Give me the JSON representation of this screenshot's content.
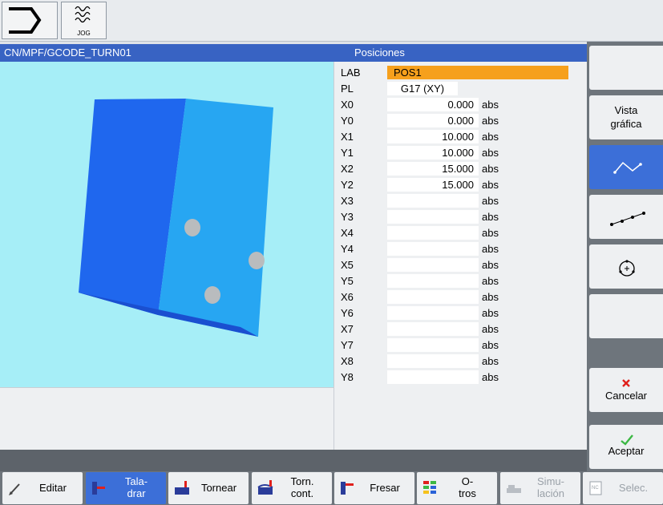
{
  "topbar": {
    "jog_label": "JOG"
  },
  "title": {
    "path": "CN/MPF/GCODE_TURN01",
    "section": "Posiciones"
  },
  "params": [
    {
      "label": "LAB",
      "value": "POS1",
      "unit": "",
      "style": "lab"
    },
    {
      "label": "PL",
      "value": "G17 (XY)",
      "unit": "",
      "style": "center"
    },
    {
      "label": "X0",
      "value": "0.000",
      "unit": "abs"
    },
    {
      "label": "Y0",
      "value": "0.000",
      "unit": "abs"
    },
    {
      "label": "X1",
      "value": "10.000",
      "unit": "abs"
    },
    {
      "label": "Y1",
      "value": "10.000",
      "unit": "abs"
    },
    {
      "label": "X2",
      "value": "15.000",
      "unit": "abs"
    },
    {
      "label": "Y2",
      "value": "15.000",
      "unit": "abs"
    },
    {
      "label": "X3",
      "value": "",
      "unit": "abs"
    },
    {
      "label": "Y3",
      "value": "",
      "unit": "abs"
    },
    {
      "label": "X4",
      "value": "",
      "unit": "abs"
    },
    {
      "label": "Y4",
      "value": "",
      "unit": "abs"
    },
    {
      "label": "X5",
      "value": "",
      "unit": "abs"
    },
    {
      "label": "Y5",
      "value": "",
      "unit": "abs"
    },
    {
      "label": "X6",
      "value": "",
      "unit": "abs"
    },
    {
      "label": "Y6",
      "value": "",
      "unit": "abs"
    },
    {
      "label": "X7",
      "value": "",
      "unit": "abs"
    },
    {
      "label": "Y7",
      "value": "",
      "unit": "abs"
    },
    {
      "label": "X8",
      "value": "",
      "unit": "abs"
    },
    {
      "label": "Y8",
      "value": "",
      "unit": "abs"
    }
  ],
  "vertical_softkeys": {
    "vista_line1": "Vista",
    "vista_line2": "gráfica",
    "cancel": "Cancelar",
    "accept": "Aceptar",
    "icons": [
      "polyline-icon",
      "line-points-icon",
      "circle-points-icon"
    ]
  },
  "horizontal_softkeys": [
    {
      "line1": "Editar",
      "line2": "",
      "icon": "pencil-icon",
      "state": "normal"
    },
    {
      "line1": "Tala-",
      "line2": "drar",
      "icon": "drill-icon",
      "state": "active"
    },
    {
      "line1": "Tornear",
      "line2": "",
      "icon": "turning-icon",
      "state": "normal"
    },
    {
      "line1": "Torn.",
      "line2": "cont.",
      "icon": "contour-turning-icon",
      "state": "normal"
    },
    {
      "line1": "Fresar",
      "line2": "",
      "icon": "milling-icon",
      "state": "normal"
    },
    {
      "line1": "O-",
      "line2": "tros",
      "icon": "others-icon",
      "state": "normal"
    },
    {
      "line1": "Simu-",
      "line2": "lación",
      "icon": "simulation-icon",
      "state": "disabled"
    },
    {
      "line1": "Selec.",
      "line2": "",
      "icon": "select-nc-icon",
      "state": "disabled"
    }
  ],
  "colors": {
    "title_bar": "#3863c3",
    "graphic_bg": "#a6eef7",
    "lab_field": "#f6a01c",
    "active_softkey": "#3c6fd8"
  }
}
